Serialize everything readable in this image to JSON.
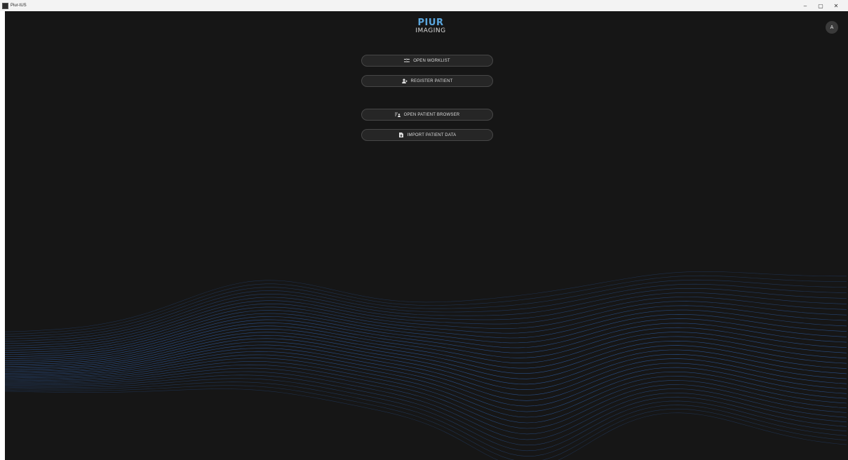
{
  "window": {
    "title": "Piur-tUS",
    "controls": {
      "minimize": "–",
      "restore": "▢",
      "close": "✕"
    }
  },
  "logo": {
    "line1": "PIUR",
    "line2": "IMAGING"
  },
  "user": {
    "avatar_initial": "A"
  },
  "menu": {
    "open_worklist": "OPEN WORKLIST",
    "register_patient": "REGISTER PATIENT",
    "open_patient_browser": "OPEN PATIENT BROWSER",
    "import_patient_data": "IMPORT PATIENT DATA"
  },
  "colors": {
    "background": "#161616",
    "accent": "#5aa6de",
    "wave": "#2f5fa8"
  }
}
